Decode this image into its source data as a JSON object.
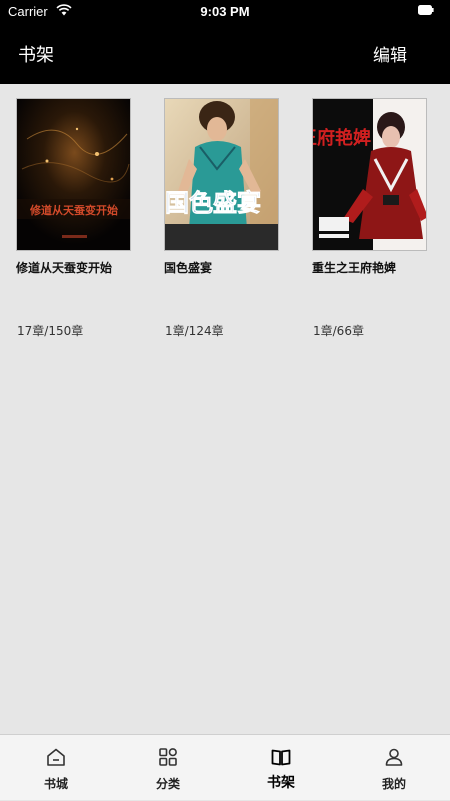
{
  "status_bar": {
    "carrier": "Carrier",
    "time": "9:03 PM"
  },
  "nav": {
    "title": "书架",
    "edit_label": "编辑"
  },
  "books": [
    {
      "title": "修道从天蚕变开始",
      "progress": "17章/150章",
      "cover_text": "修道从天蚕变开始",
      "cover_icon": "dark-fiery-cover"
    },
    {
      "title": "国色盛宴",
      "progress": "1章/124章",
      "cover_text": "国色盛宴",
      "cover_icon": "woman-teal-dress-cover"
    },
    {
      "title": "重生之王府艳婢",
      "progress": "1章/66章",
      "cover_text": "王府艳婢",
      "cover_icon": "red-robe-woman-cover"
    }
  ],
  "tabs": [
    {
      "label": "书城",
      "icon": "home-icon",
      "active": false
    },
    {
      "label": "分类",
      "icon": "grid-icon",
      "active": false
    },
    {
      "label": "书架",
      "icon": "book-icon",
      "active": true
    },
    {
      "label": "我的",
      "icon": "user-icon",
      "active": false
    }
  ],
  "colors": {
    "header_bg": "#000000",
    "page_bg": "#e6e6e6",
    "tabbar_bg": "#f4f4f4"
  }
}
